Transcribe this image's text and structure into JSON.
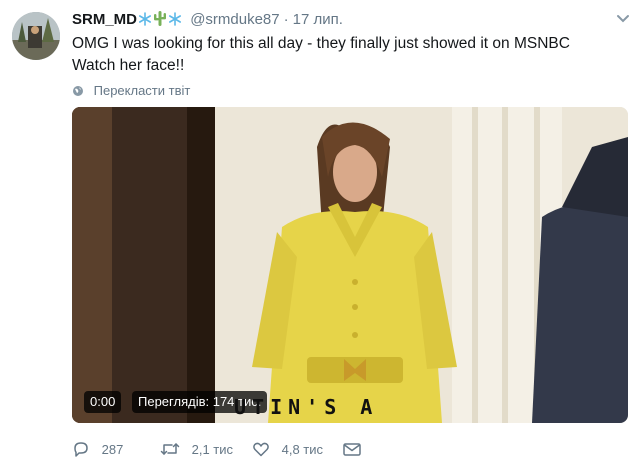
{
  "author": {
    "name": "SRM_MD",
    "name_emojis": [
      "snowflake-icon",
      "cactus-icon",
      "snowflake-icon"
    ],
    "handle": "@srmduke87",
    "separator": "·",
    "date": "17 лип."
  },
  "tweet": {
    "line1": "OMG I was looking for this all day - they finally just showed it on MSNBC",
    "line2": "Watch her face!!"
  },
  "translate_label": "Перекласти твіт",
  "video": {
    "time": "0:00",
    "views": "Переглядів: 174 тис.",
    "caption": "UTIN'S A"
  },
  "actions": {
    "replies": "287",
    "retweets": "2,1 тис",
    "likes": "4,8 тис"
  },
  "colors": {
    "text": "#14171a",
    "secondary": "#657786",
    "snowflake": "#5bb8e8",
    "cactus": "#78b159",
    "dress": "#e6d449"
  }
}
